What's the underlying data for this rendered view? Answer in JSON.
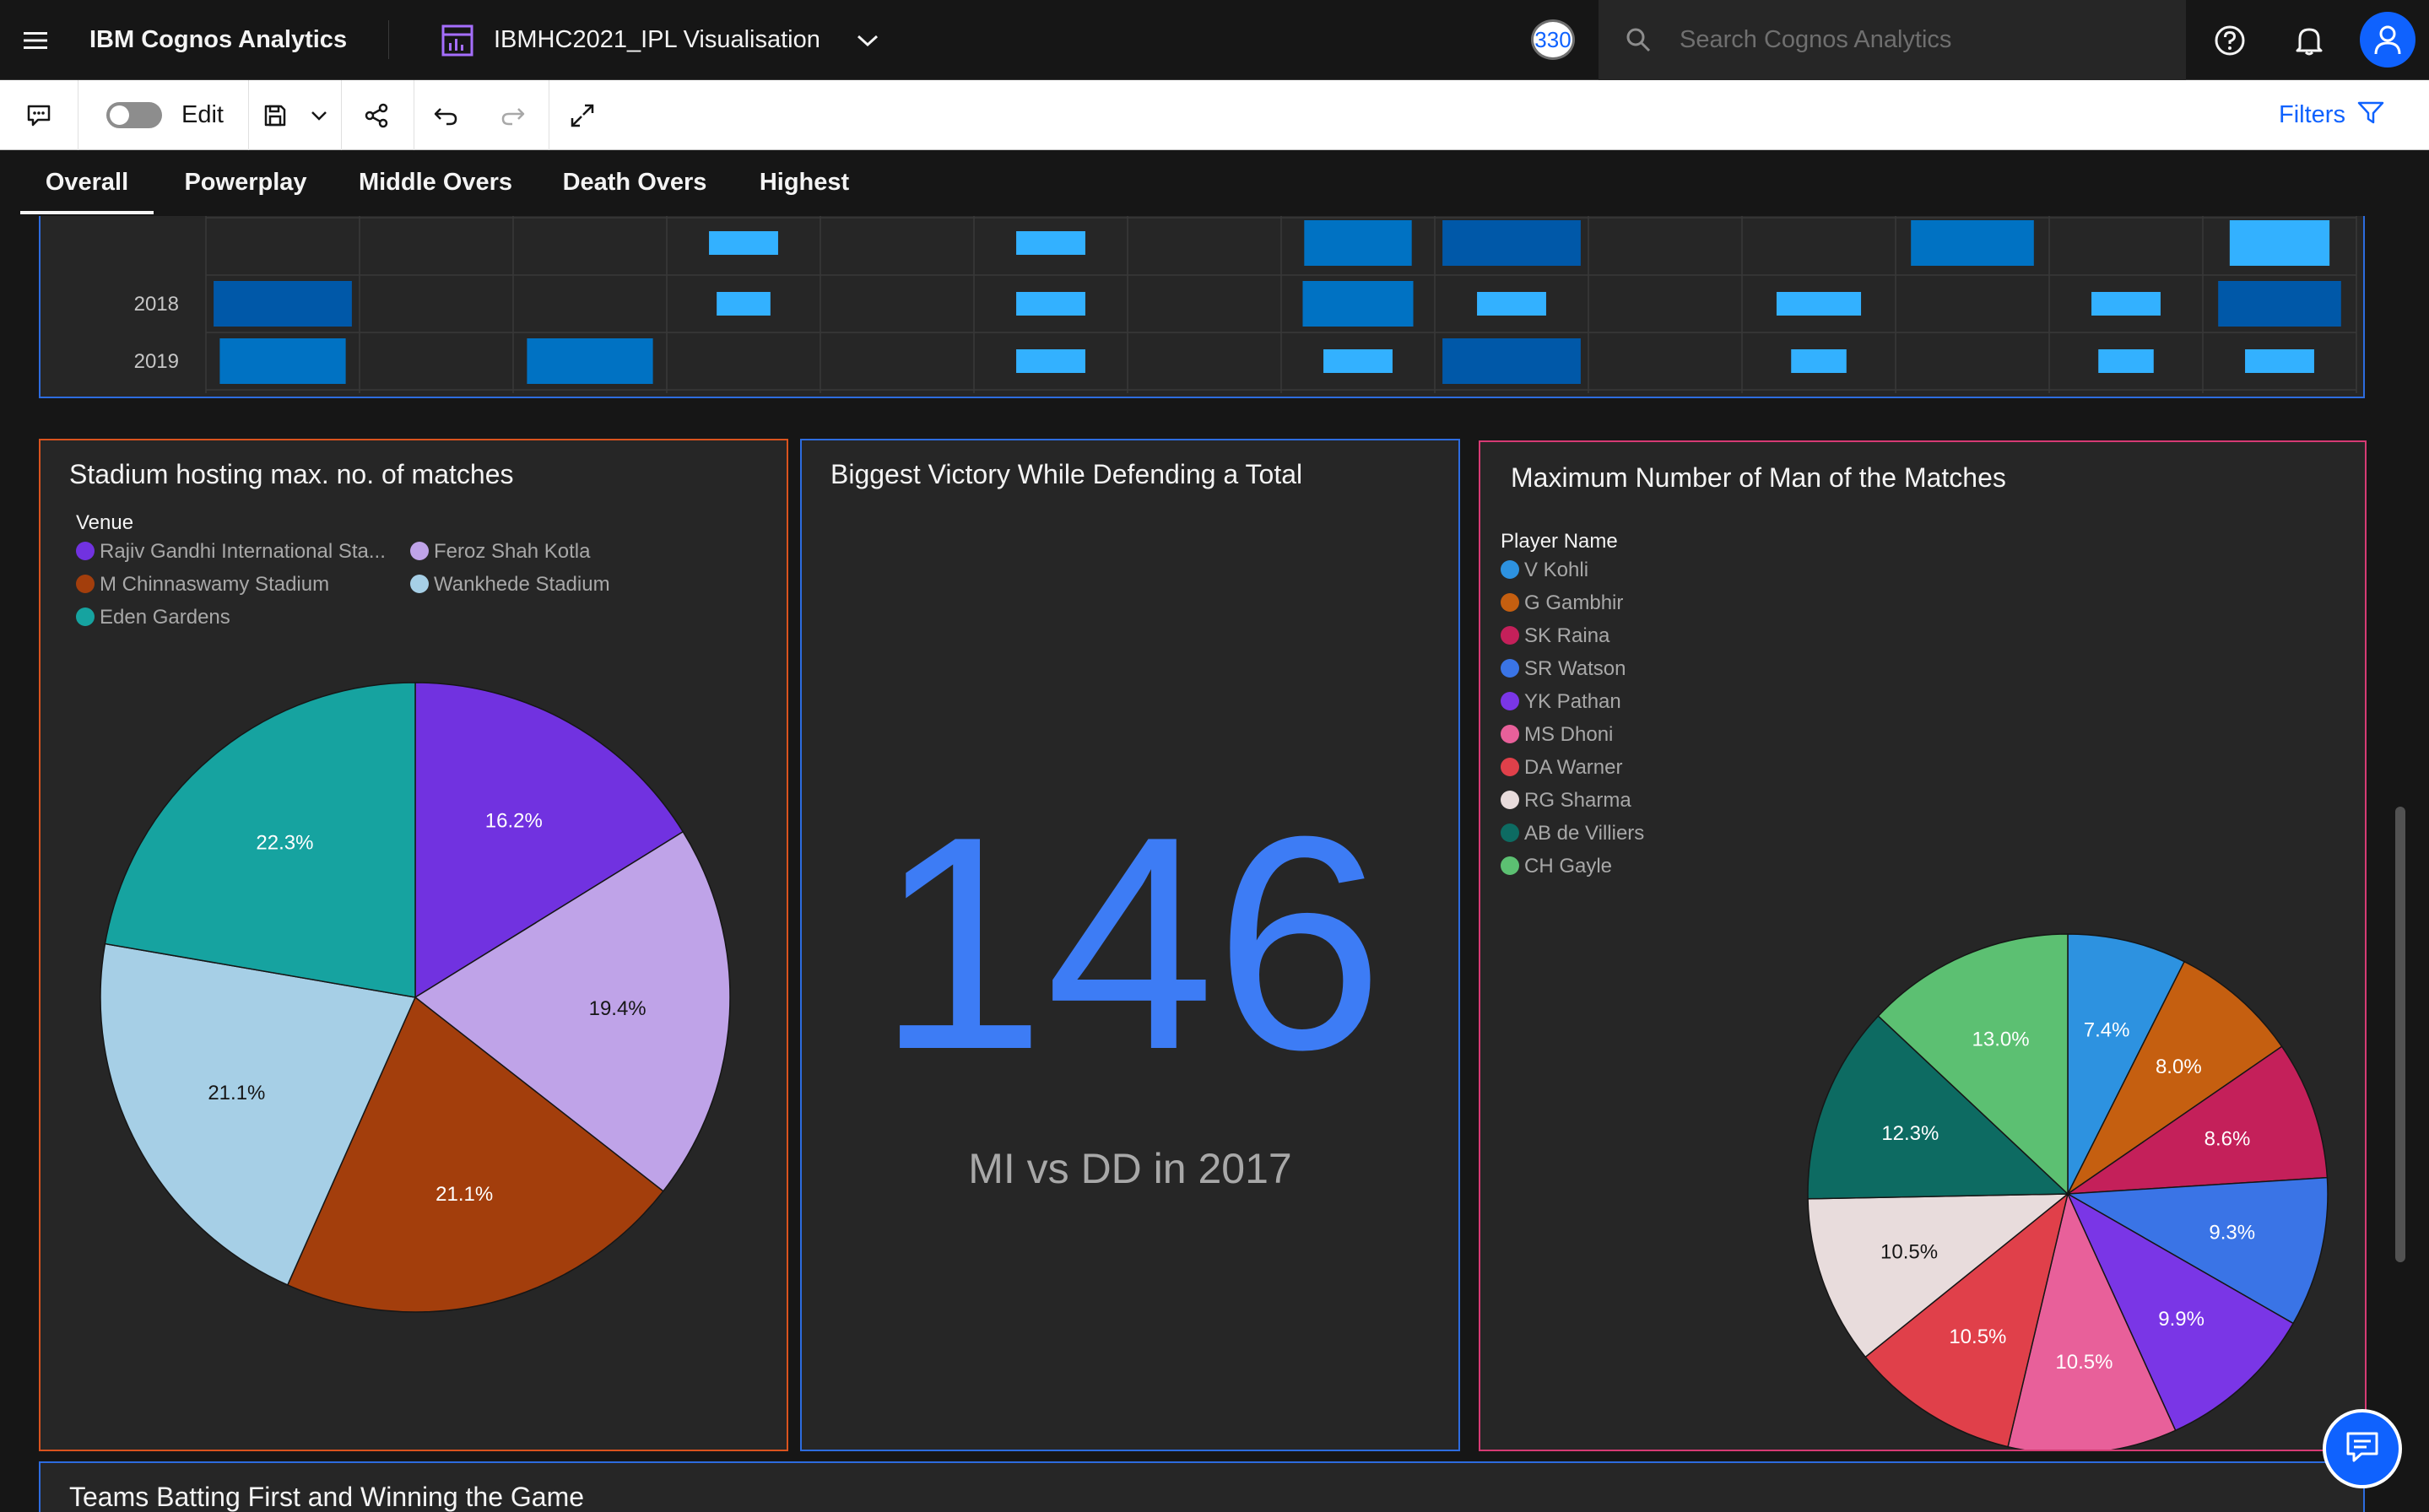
{
  "header": {
    "app_title": "IBM Cognos Analytics",
    "report_title": "IBMHC2021_IPL Visualisation",
    "user_count": "330",
    "search_placeholder": "Search Cognos Analytics"
  },
  "toolbar": {
    "edit_label": "Edit",
    "filters_label": "Filters",
    "edit_on": false
  },
  "tabs": [
    {
      "label": "Overall",
      "active": true
    },
    {
      "label": "Powerplay",
      "active": false
    },
    {
      "label": "Middle Overs",
      "active": false
    },
    {
      "label": "Death Overs",
      "active": false
    },
    {
      "label": "Highest",
      "active": false
    }
  ],
  "heatmap": {
    "rows": [
      "2018",
      "2019"
    ],
    "colors": {
      "dark": "#0058a8",
      "mid": "#0072c3",
      "light": "#33b1ff"
    }
  },
  "stadium_widget": {
    "title": "Stadium hosting max. no. of matches",
    "legend_title": "Venue",
    "legend": [
      {
        "label": "Rajiv Gandhi International Sta...",
        "color": "#7132e0"
      },
      {
        "label": "Feroz Shah Kotla",
        "color": "#bfa3e8"
      },
      {
        "label": "M Chinnaswamy Stadium",
        "color": "#a33e0c"
      },
      {
        "label": "Wankhede Stadium",
        "color": "#a6cfe6"
      },
      {
        "label": "Eden Gardens",
        "color": "#16a3a0"
      }
    ]
  },
  "victory_widget": {
    "title": "Biggest Victory While Defending a Total",
    "value": "146",
    "subtitle": "MI vs DD in 2017",
    "value_color": "#3d7cf5"
  },
  "mom_widget": {
    "title": "Maximum Number of Man of the Matches",
    "legend_title": "Player Name",
    "legend": [
      {
        "label": "V Kohli",
        "color": "#2d92e0"
      },
      {
        "label": "G Gambhir",
        "color": "#c55f10"
      },
      {
        "label": "SK Raina",
        "color": "#c4205a"
      },
      {
        "label": "SR Watson",
        "color": "#3a74e6"
      },
      {
        "label": "YK Pathan",
        "color": "#7a36e6"
      },
      {
        "label": "MS Dhoni",
        "color": "#e8609a"
      },
      {
        "label": "DA Warner",
        "color": "#e0404a"
      },
      {
        "label": "RG Sharma",
        "color": "#e8dcdc"
      },
      {
        "label": "AB de Villiers",
        "color": "#0d6b62"
      },
      {
        "label": "CH Gayle",
        "color": "#5cc072"
      }
    ]
  },
  "teams_widget": {
    "title": "Teams Batting First and Winning the Game"
  },
  "chart_data": [
    {
      "type": "pie",
      "labels": [
        "Rajiv Gandhi International Sta...",
        "Feroz Shah Kotla",
        "M Chinnaswamy Stadium",
        "Wankhede Stadium",
        "Eden Gardens"
      ],
      "values": [
        16.2,
        19.4,
        21.1,
        21.1,
        22.3
      ],
      "data_labels": [
        "16.2%",
        "19.4%",
        "21.1%",
        "21.1%",
        "22.3%"
      ],
      "colors": [
        "#7132e0",
        "#bfa3e8",
        "#a33e0c",
        "#a6cfe6",
        "#16a3a0"
      ]
    },
    {
      "type": "pie",
      "labels": [
        "V Kohli",
        "G Gambhir",
        "SK Raina",
        "SR Watson",
        "YK Pathan",
        "MS Dhoni",
        "DA Warner",
        "RG Sharma",
        "AB de Villiers",
        "CH Gayle"
      ],
      "values": [
        7.4,
        8.0,
        8.6,
        9.3,
        9.9,
        10.5,
        10.5,
        10.5,
        12.3,
        13.0
      ],
      "data_labels": [
        "7.4%",
        "8.0%",
        "8.6%",
        "9.3%",
        "9.9%",
        "10.5%",
        "10.5%",
        "10.5%",
        "12.3%",
        "13.0%"
      ],
      "colors": [
        "#2d92e0",
        "#c55f10",
        "#c4205a",
        "#3a74e6",
        "#7a36e6",
        "#e8609a",
        "#e0404a",
        "#e8dcdc",
        "#0d6b62",
        "#5cc072"
      ]
    }
  ]
}
